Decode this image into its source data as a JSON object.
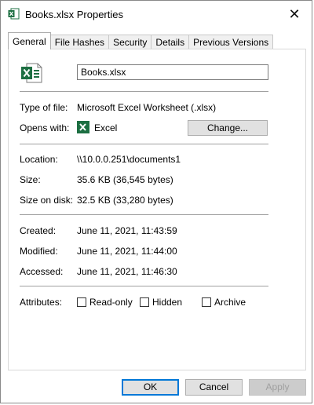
{
  "window": {
    "title": "Books.xlsx Properties",
    "close_glyph": "✕"
  },
  "tabs": [
    {
      "label": "General",
      "active": true
    },
    {
      "label": "File Hashes",
      "active": false
    },
    {
      "label": "Security",
      "active": false
    },
    {
      "label": "Details",
      "active": false
    },
    {
      "label": "Previous Versions",
      "active": false
    }
  ],
  "general": {
    "file_name": "Books.xlsx",
    "type_label": "Type of file:",
    "type_value": "Microsoft Excel Worksheet (.xlsx)",
    "opens_label": "Opens with:",
    "opens_value": "Excel",
    "change_label": "Change...",
    "location_label": "Location:",
    "location_value": "\\\\10.0.0.251\\documents1",
    "size_label": "Size:",
    "size_value": "35.6 KB (36,545 bytes)",
    "size_disk_label": "Size on disk:",
    "size_disk_value": "32.5 KB (33,280 bytes)",
    "created_label": "Created:",
    "created_value": "June 11, 2021, 11:43:59",
    "modified_label": "Modified:",
    "modified_value": "June 11, 2021, 11:44:00",
    "accessed_label": "Accessed:",
    "accessed_value": "June 11, 2021, 11:46:30",
    "attributes_label": "Attributes:",
    "attributes": [
      {
        "label": "Read-only",
        "checked": false
      },
      {
        "label": "Hidden",
        "checked": false
      },
      {
        "label": "Archive",
        "checked": false
      }
    ]
  },
  "buttons": {
    "ok": "OK",
    "cancel": "Cancel",
    "apply": "Apply"
  },
  "colors": {
    "excel_green": "#1d6f42",
    "focus_blue": "#0078d7"
  },
  "icons": {
    "title": "excel-file-icon",
    "app": "excel-app-icon",
    "file": "excel-document-icon"
  }
}
